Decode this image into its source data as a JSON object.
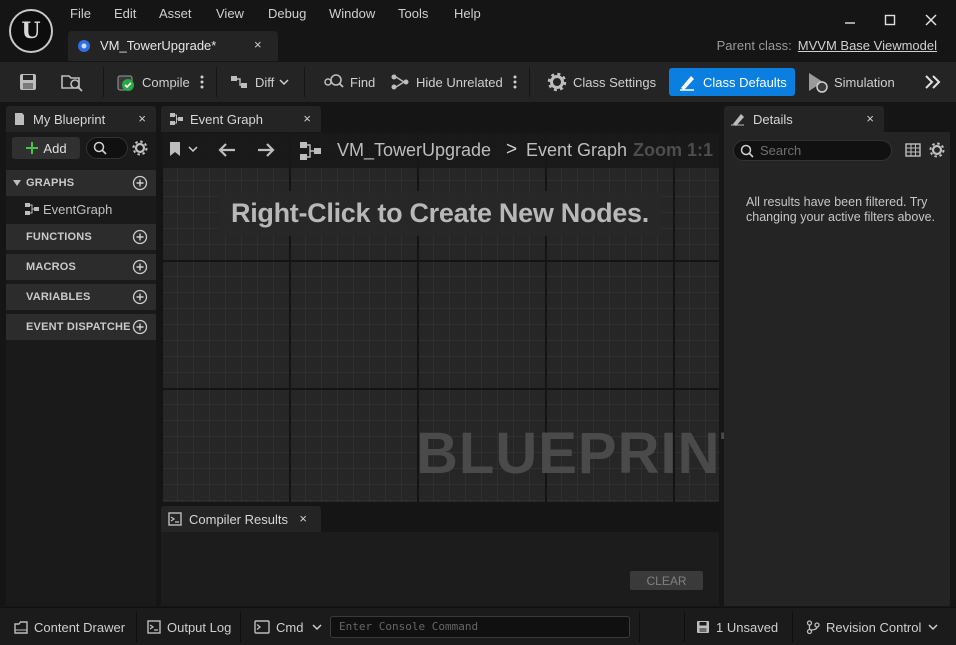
{
  "menu": [
    "File",
    "Edit",
    "Asset",
    "View",
    "Debug",
    "Window",
    "Tools",
    "Help"
  ],
  "document_tab": {
    "label": "VM_TowerUpgrade*",
    "close": "×"
  },
  "parent_class": {
    "label": "Parent class:",
    "value": "MVVM Base Viewmodel"
  },
  "toolbar": {
    "compile": "Compile",
    "diff": "Diff",
    "find": "Find",
    "hide_unrelated": "Hide Unrelated",
    "class_settings": "Class Settings",
    "class_defaults": "Class Defaults",
    "simulation": "Simulation",
    "more": "»"
  },
  "my_blueprint": {
    "tab": "My Blueprint",
    "add": "Add",
    "sections": {
      "graphs": "GRAPHS",
      "functions": "FUNCTIONS",
      "macros": "MACROS",
      "variables": "VARIABLES",
      "event_dispatchers": "EVENT DISPATCHERS"
    },
    "graph_items": [
      "EventGraph"
    ]
  },
  "graph": {
    "tab": "Event Graph",
    "breadcrumb_root": "VM_TowerUpgrade",
    "breadcrumb_sep": ">",
    "breadcrumb_current": "Event Graph",
    "zoom": "Zoom 1:1",
    "hint": "Right-Click to Create New Nodes.",
    "watermark": "BLUEPRINT"
  },
  "compiler": {
    "tab": "Compiler Results",
    "clear": "CLEAR"
  },
  "details": {
    "tab": "Details",
    "search_placeholder": "Search",
    "message": "All results have been filtered. Try changing your active filters above."
  },
  "statusbar": {
    "content_drawer": "Content Drawer",
    "output_log": "Output Log",
    "cmd": "Cmd",
    "console_placeholder": "Enter Console Command",
    "unsaved": "1 Unsaved",
    "revision_control": "Revision Control"
  },
  "colors": {
    "accent": "#0a7fe0",
    "background": "#151515",
    "panel": "#242424"
  }
}
